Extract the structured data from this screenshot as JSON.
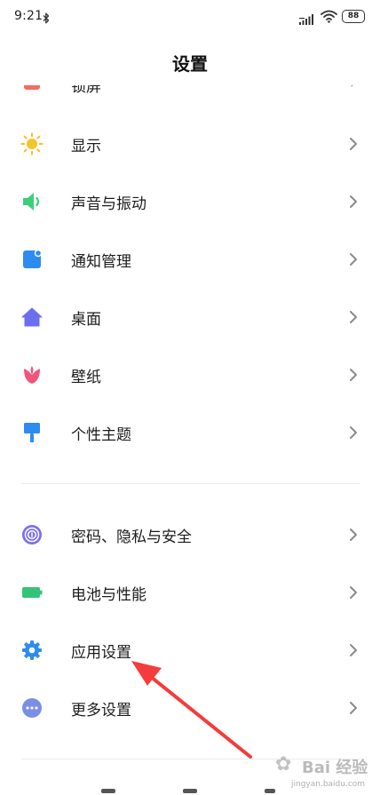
{
  "status_bar": {
    "time": "9:21",
    "battery": "88"
  },
  "header": {
    "title": "设置"
  },
  "partial_item": {
    "label": "锁屏"
  },
  "settings": {
    "group1": [
      {
        "label": "显示",
        "icon": "brightness-icon",
        "color": "#f8c22c"
      },
      {
        "label": "声音与振动",
        "icon": "speaker-icon",
        "color": "#3ccf7a"
      },
      {
        "label": "通知管理",
        "icon": "notification-icon",
        "color": "#2d8cf0"
      },
      {
        "label": "桌面",
        "icon": "home-icon",
        "color": "#6b6fef"
      },
      {
        "label": "壁纸",
        "icon": "tulip-icon",
        "color": "#f0567a"
      },
      {
        "label": "个性主题",
        "icon": "paint-brush-icon",
        "color": "#2d8cf0"
      }
    ],
    "group2": [
      {
        "label": "密码、隐私与安全",
        "icon": "fingerprint-icon",
        "color": "#7c6ff0"
      },
      {
        "label": "电池与性能",
        "icon": "battery-icon",
        "color": "#34c477"
      },
      {
        "label": "应用设置",
        "icon": "gear-icon",
        "color": "#2d8cf0"
      },
      {
        "label": "更多设置",
        "icon": "more-icon",
        "color": "#7a8ee8"
      }
    ]
  },
  "annotation": {
    "color": "#f53b3b"
  },
  "watermark": {
    "brand": "Bai 经验",
    "url": "jingyan.baidu.com"
  }
}
